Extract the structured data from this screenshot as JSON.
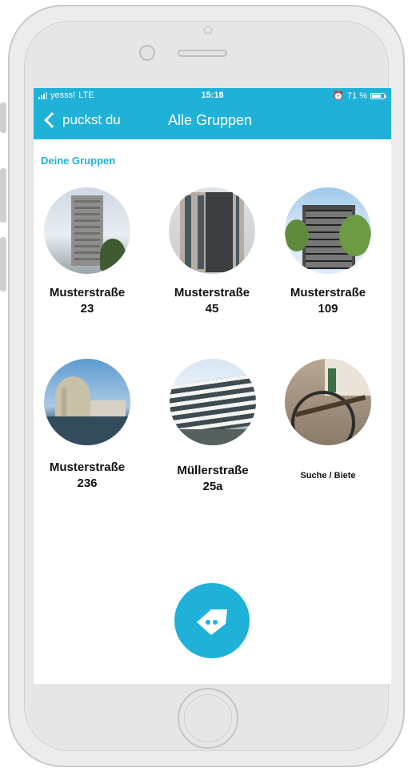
{
  "status_bar": {
    "carrier": "yesss!",
    "network": "LTE",
    "time": "15:18",
    "battery": "71 %",
    "battery_level_percent": 71
  },
  "nav": {
    "back_label": "puckst du",
    "title": "Alle Gruppen"
  },
  "section": {
    "title": "Deine Gruppen"
  },
  "groups": [
    {
      "line1": "Musterstraße",
      "line2": "23"
    },
    {
      "line1": "Musterstraße",
      "line2": "45"
    },
    {
      "line1": "Musterstraße",
      "line2": "109"
    },
    {
      "line1": "Musterstraße",
      "line2": "236"
    },
    {
      "line1": "Müllerstraße",
      "line2": "25a"
    },
    {
      "line1": "Suche / Biete",
      "line2": ""
    }
  ],
  "colors": {
    "accent": "#1fb1d8"
  },
  "icons": {
    "fab": "tag-icon",
    "back": "chevron-left-icon"
  }
}
